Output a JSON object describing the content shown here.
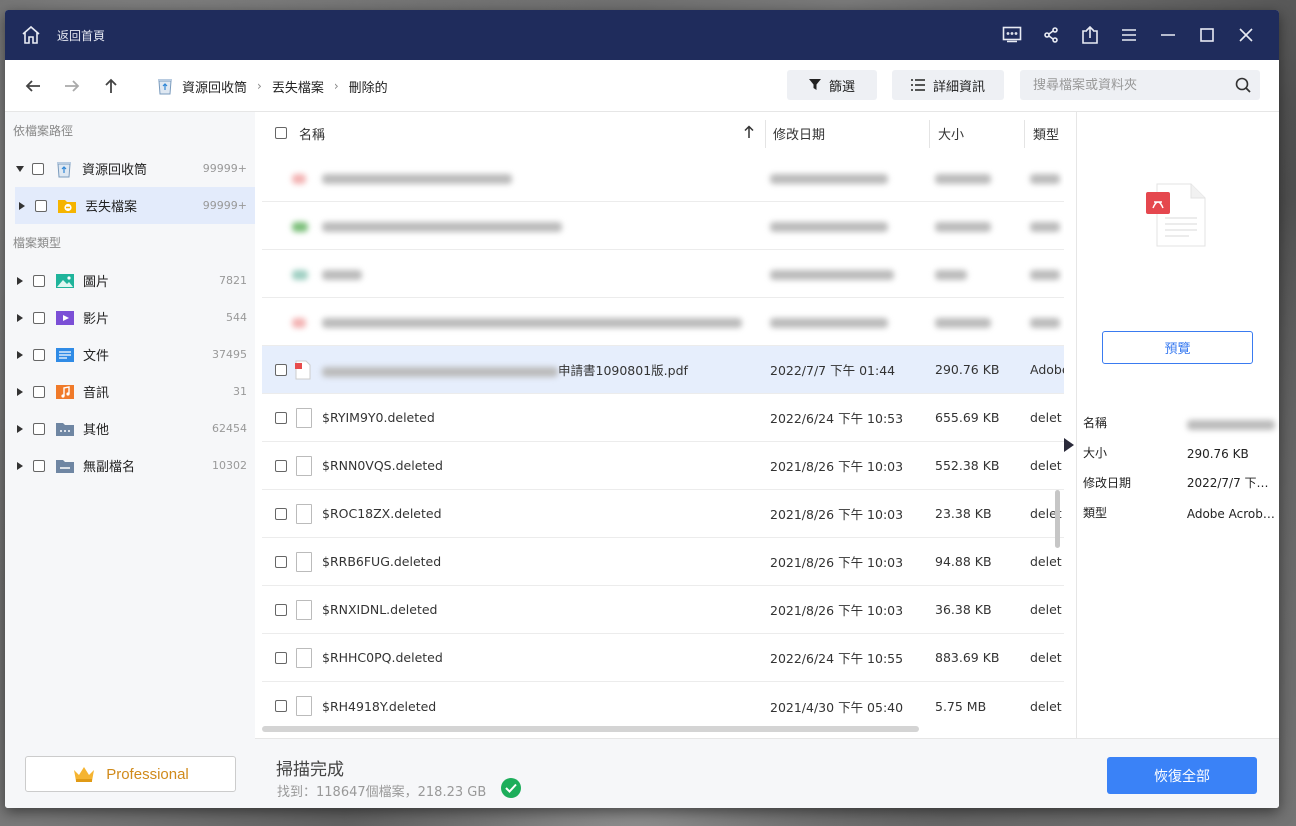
{
  "window": {
    "home_label": "返回首頁"
  },
  "navbar": {
    "breadcrumb": [
      "資源回收筒",
      "丟失檔案",
      "刪除的"
    ],
    "filter_label": "篩選",
    "details_label": "詳細資訊",
    "search_placeholder": "搜尋檔案或資料夾"
  },
  "sidebar": {
    "path_header": "依檔案路徑",
    "path_items": [
      {
        "label": "資源回收筒",
        "count": "99999+"
      },
      {
        "label": "丟失檔案",
        "count": "99999+"
      }
    ],
    "type_header": "檔案類型",
    "type_items": [
      {
        "label": "圖片",
        "count": "7821"
      },
      {
        "label": "影片",
        "count": "544"
      },
      {
        "label": "文件",
        "count": "37495"
      },
      {
        "label": "音訊",
        "count": "31"
      },
      {
        "label": "其他",
        "count": "62454"
      },
      {
        "label": "無副檔名",
        "count": "10302"
      }
    ],
    "pro_label": "Professional"
  },
  "list": {
    "headers": {
      "name": "名稱",
      "date": "修改日期",
      "size": "大小",
      "type": "類型"
    },
    "selected_row": {
      "name_suffix": "申請書1090801版.pdf",
      "date": "2022/7/7 下午 01:44",
      "size": "290.76 KB",
      "type": "Adobe"
    },
    "rows": [
      {
        "name": "$RYIM9Y0.deleted",
        "date": "2022/6/24 下午 10:53",
        "size": "655.69 KB",
        "type": "delet"
      },
      {
        "name": "$RNN0VQS.deleted",
        "date": "2021/8/26 下午 10:03",
        "size": "552.38 KB",
        "type": "delet"
      },
      {
        "name": "$ROC18ZX.deleted",
        "date": "2021/8/26 下午 10:03",
        "size": "23.38 KB",
        "type": "delet"
      },
      {
        "name": "$RRB6FUG.deleted",
        "date": "2021/8/26 下午 10:03",
        "size": "94.88 KB",
        "type": "delet"
      },
      {
        "name": "$RNXIDNL.deleted",
        "date": "2021/8/26 下午 10:03",
        "size": "36.38 KB",
        "type": "delet"
      },
      {
        "name": "$RHHC0PQ.deleted",
        "date": "2022/6/24 下午 10:55",
        "size": "883.69 KB",
        "type": "delet"
      },
      {
        "name": "$RH4918Y.deleted",
        "date": "2021/4/30 下午 05:40",
        "size": "5.75 MB",
        "type": "delet"
      }
    ]
  },
  "preview": {
    "button_label": "預覽",
    "fields": [
      {
        "key": "名稱",
        "value": ""
      },
      {
        "key": "大小",
        "value": "290.76 KB"
      },
      {
        "key": "修改日期",
        "value": "2022/7/7 下午 ..."
      },
      {
        "key": "類型",
        "value": "Adobe Acrobat..."
      }
    ]
  },
  "footer": {
    "scan_title": "掃描完成",
    "scan_summary": "找到：118647個檔案，218.23 GB",
    "recover_label": "恢復全部"
  }
}
